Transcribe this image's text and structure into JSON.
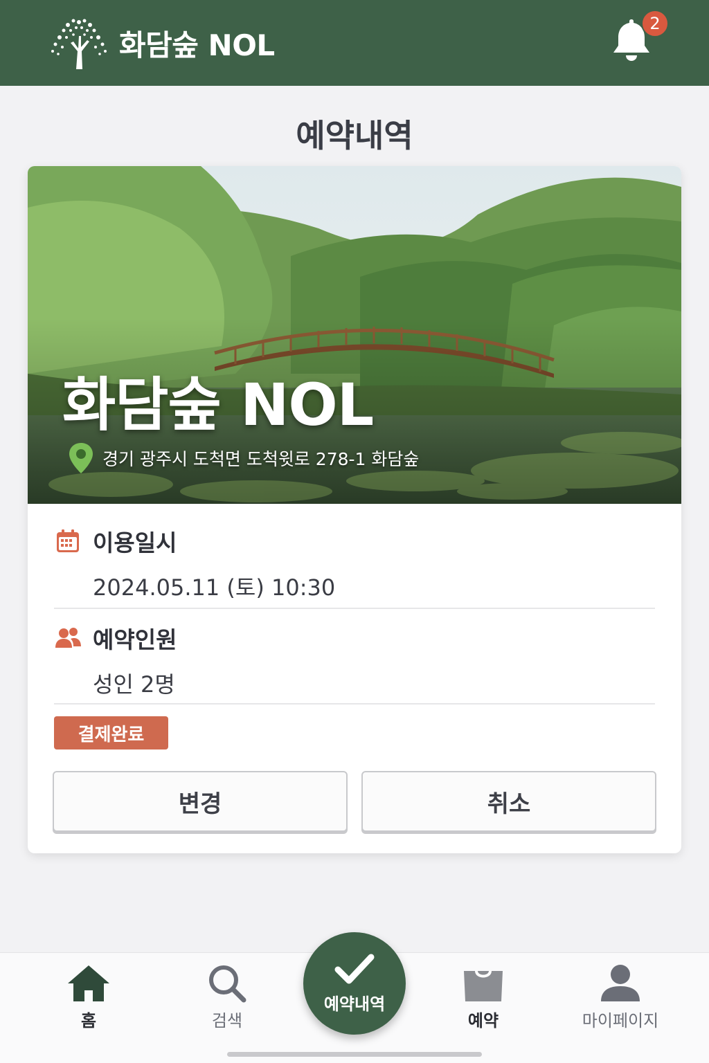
{
  "header": {
    "brand": "화담숲 NOL",
    "notification_count": "2",
    "colors": {
      "primary": "#3e6148",
      "badge": "#d9593f"
    }
  },
  "page": {
    "title": "예약내역"
  },
  "reservation": {
    "place_name": "화담숲 NOL",
    "address": "경기 광주시 도척면 도척윗로 278-1 화담숲",
    "date_label": "이용일시",
    "date_value": "2024.05.11 (토) 10:30",
    "people_label": "예약인원",
    "people_value": "성인 2명",
    "status": "결제완료",
    "status_color": "#cf6a4f",
    "change_button": "변경",
    "cancel_button": "취소"
  },
  "bottom_nav": {
    "items": [
      {
        "label": "홈",
        "icon": "home-icon",
        "active": true
      },
      {
        "label": "검색",
        "icon": "search-icon",
        "active": false
      },
      {
        "label": "예약내역",
        "icon": "check-icon",
        "active": true
      },
      {
        "label": "예약",
        "icon": "bag-icon",
        "active": false
      },
      {
        "label": "마이페이지",
        "icon": "user-icon",
        "active": false
      }
    ]
  }
}
